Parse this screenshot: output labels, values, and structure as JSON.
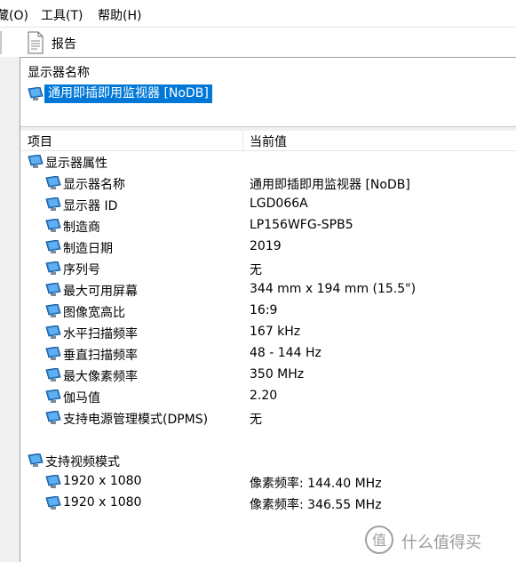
{
  "menubar": {
    "items": [
      "藏(O)",
      "工具(T)",
      "帮助(H)"
    ]
  },
  "toolbar": {
    "report_label": "报告"
  },
  "top_pane": {
    "label": "显示器名称",
    "selected_device": "通用即插即用监视器 [NoDB]"
  },
  "details": {
    "columns": {
      "item": "项目",
      "value": "当前值"
    },
    "section1": {
      "title": "显示器属性",
      "rows": [
        {
          "name": "显示器名称",
          "value": "通用即插即用监视器 [NoDB]"
        },
        {
          "name": "显示器 ID",
          "value": "LGD066A"
        },
        {
          "name": "制造商",
          "value": "LP156WFG-SPB5"
        },
        {
          "name": "制造日期",
          "value": "2019"
        },
        {
          "name": "序列号",
          "value": "无"
        },
        {
          "name": "最大可用屏幕",
          "value": "344 mm x 194 mm (15.5\")"
        },
        {
          "name": "图像宽高比",
          "value": "16:9"
        },
        {
          "name": "水平扫描频率",
          "value": "167 kHz"
        },
        {
          "name": "垂直扫描频率",
          "value": "48 - 144 Hz"
        },
        {
          "name": "最大像素频率",
          "value": "350 MHz"
        },
        {
          "name": "伽马值",
          "value": "2.20"
        },
        {
          "name": "支持电源管理模式(DPMS)",
          "value": "无"
        }
      ]
    },
    "section2": {
      "title": "支持视频模式",
      "rows": [
        {
          "name": "1920 x 1080",
          "value": "像素频率: 144.40 MHz"
        },
        {
          "name": "1920 x 1080",
          "value": "像素频率: 346.55 MHz"
        }
      ]
    }
  },
  "watermark": {
    "text": "什么值得买"
  },
  "colors": {
    "selection": "#0078d7",
    "monitor_icon": "#1e78c8"
  },
  "icons": {
    "report": "document-icon",
    "monitor": "monitor-icon",
    "watermark": "smzdm-logo"
  }
}
